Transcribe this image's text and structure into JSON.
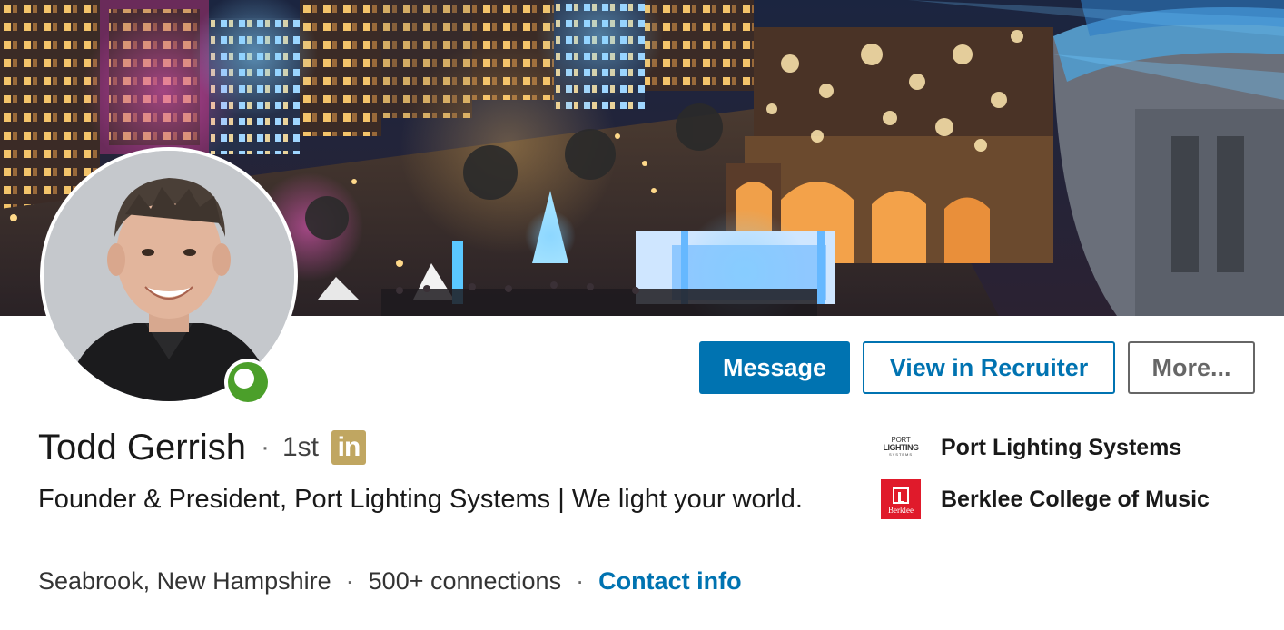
{
  "profile": {
    "name": "Todd Gerrish",
    "degree": "1st",
    "badge_text": "in",
    "headline": "Founder & President, Port Lighting Systems | We light your world.",
    "location": "Seabrook, New Hampshire",
    "connections": "500+ connections",
    "contact_link": "Contact info",
    "separator": "·",
    "presence_status": "online"
  },
  "actions": {
    "message": "Message",
    "view_in_recruiter": "View in Recruiter",
    "more": "More..."
  },
  "organizations": [
    {
      "name": "Port Lighting Systems",
      "logo_icon": "port-lighting-logo",
      "logo_text": [
        "PORT",
        "LIGHTING",
        "SYSTEMS"
      ]
    },
    {
      "name": "Berklee College of Music",
      "logo_icon": "berklee-logo",
      "logo_text": "Berklee"
    }
  ],
  "colors": {
    "primary_blue": "#0073b1",
    "premium_gold": "#c0a661",
    "presence_green": "#4b9f2a",
    "berklee_red": "#e01a2b"
  }
}
